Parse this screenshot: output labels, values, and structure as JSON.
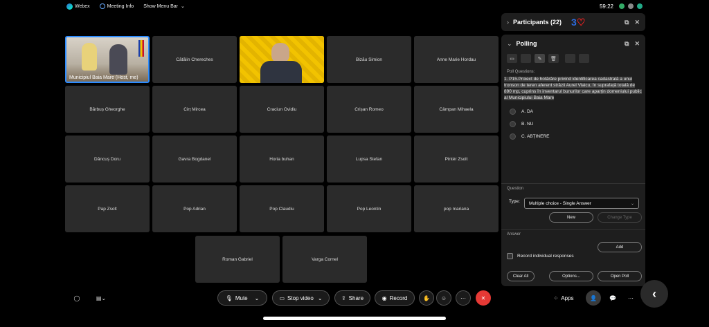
{
  "menubar": {
    "app_name": "Webex",
    "meeting_info": "Meeting Info",
    "show_menu_bar": "Show Menu Bar",
    "clock": "59:22"
  },
  "tiles": [
    {
      "name": "Municipiul Baia Mare (Host, me)",
      "video": true,
      "host": true
    },
    {
      "name": "Cătălin Chereches"
    },
    {
      "name": "",
      "video": true
    },
    {
      "name": "Bizău Simion"
    },
    {
      "name": "Anne Marie Hordau"
    },
    {
      "name": "Bărbuș Gheorghe"
    },
    {
      "name": "Cirț Mircea"
    },
    {
      "name": "Craciun Ovidiu"
    },
    {
      "name": "Crișan Romeo"
    },
    {
      "name": "Câmpan Mihaela"
    },
    {
      "name": "Dăncuș Doru"
    },
    {
      "name": "Gavra Bogdanel"
    },
    {
      "name": "Horia buhan"
    },
    {
      "name": "Lupsa Stefan"
    },
    {
      "name": "Pintér Zsolt"
    },
    {
      "name": "Pap Zsolt"
    },
    {
      "name": "Pop Adrian"
    },
    {
      "name": "Pop Claudiu"
    },
    {
      "name": "Pop Leontin"
    },
    {
      "name": "pop mariana"
    },
    {
      "name": "Roman Gabriel"
    },
    {
      "name": "Varga Cornel"
    }
  ],
  "participants_panel": {
    "title": "Participants (22)"
  },
  "polling": {
    "title": "Polling",
    "poll_questions_label": "Poll Questions:",
    "question_text": "1.  P15.Proiect de hotărâre privind identificarea cadastrală a unui tronson de teren aferent străzii Aurel Vlaicu, în suprafață totală de 890 mp, cuprins în inventarul bunurilor care aparțin domeniului public al Municipiului Baia Mare",
    "options": [
      "A.  DA",
      "B.  NU",
      "C.  ABȚINERE"
    ],
    "question_section": "Question",
    "type_label": "Type:",
    "type_value": "Multiple choice - Single Answer",
    "new_button": "New",
    "change_type_button": "Change Type",
    "answer_section": "Answer",
    "add_button": "Add",
    "record_label": "Record individual responses",
    "clear_all_button": "Clear All",
    "options_button": "Options...",
    "open_poll_button": "Open Poll"
  },
  "controls": {
    "mute": "Mute",
    "stop_video": "Stop video",
    "share": "Share",
    "record": "Record",
    "apps": "Apps"
  }
}
